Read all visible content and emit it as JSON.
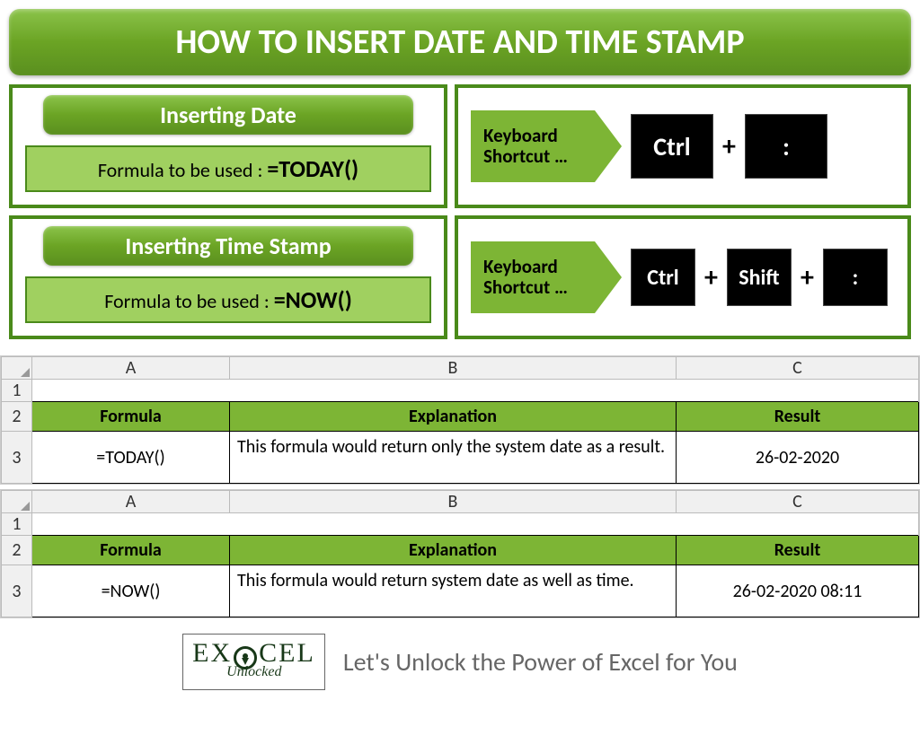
{
  "title": "HOW TO INSERT DATE AND TIME STAMP",
  "section1": {
    "heading": "Inserting Date",
    "formula_label": "Formula to be used : ",
    "formula": "=TODAY()",
    "shortcut_label1": "Keyboard",
    "shortcut_label2": "Shortcut …",
    "keys": [
      "Ctrl",
      ":"
    ]
  },
  "section2": {
    "heading": "Inserting Time Stamp",
    "formula_label": "Formula to be used : ",
    "formula": "=NOW()",
    "shortcut_label1": "Keyboard",
    "shortcut_label2": "Shortcut …",
    "keys": [
      "Ctrl",
      "Shift",
      ":"
    ]
  },
  "table_headers": {
    "a": "Formula",
    "b": "Explanation",
    "c": "Result"
  },
  "col_labels": {
    "a": "A",
    "b": "B",
    "c": "C"
  },
  "row_labels": {
    "r1": "1",
    "r2": "2",
    "r3": "3"
  },
  "table1": {
    "formula": "=TODAY()",
    "explanation": "This formula would return only the system date as a result.",
    "result": "26-02-2020"
  },
  "table2": {
    "formula": "=NOW()",
    "explanation": "This formula would return system date as well as time.",
    "result": "26-02-2020 08:11"
  },
  "footer": {
    "logo_top": "E   CEL",
    "logo_x": "X",
    "logo_bottom": "Unlocked",
    "tagline": "Let's Unlock the Power of Excel for You"
  },
  "plus": "+"
}
